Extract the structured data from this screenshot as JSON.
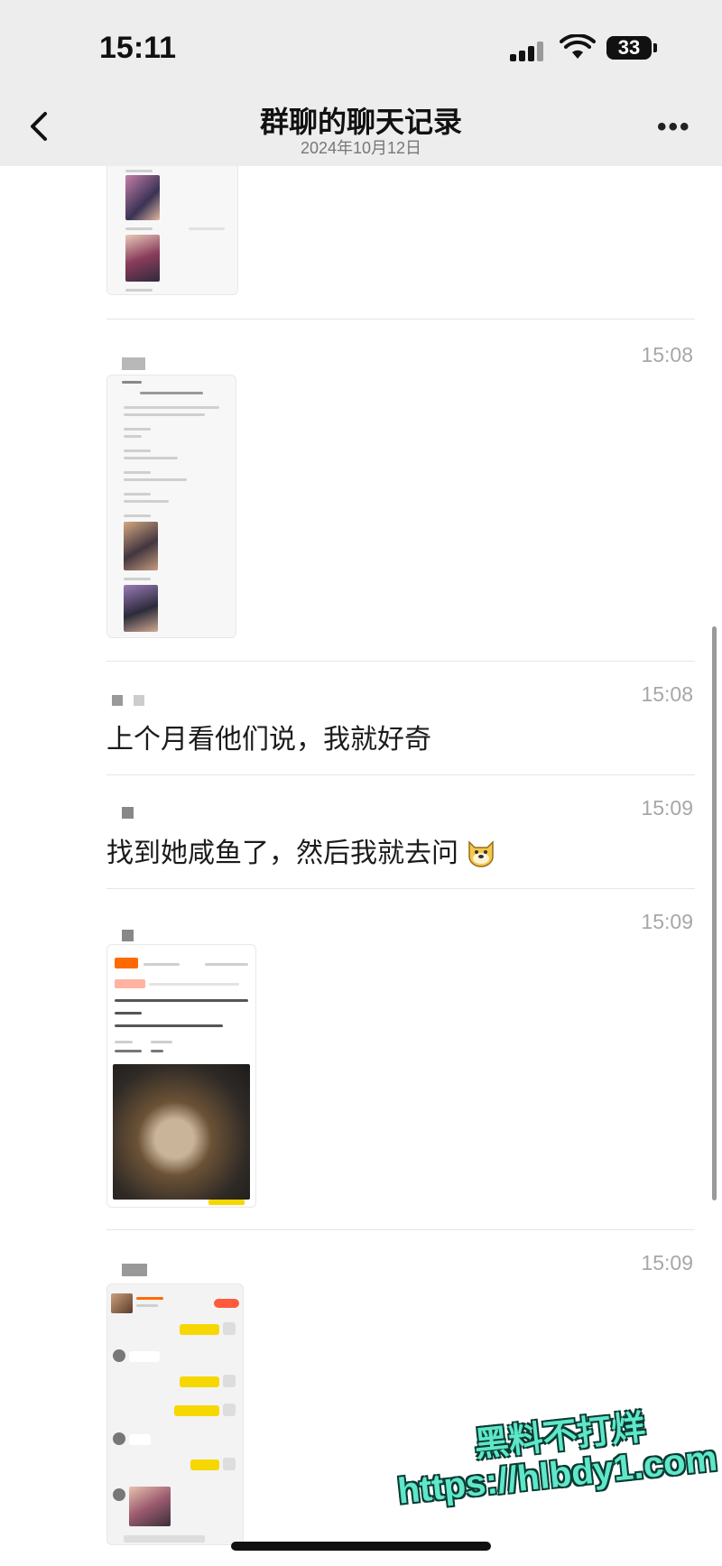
{
  "status_bar": {
    "time": "15:11",
    "battery": "33"
  },
  "nav": {
    "title": "群聊的聊天记录",
    "subtitle": "2024年10月12日"
  },
  "messages": [
    {
      "time": "15:08",
      "type": "image"
    },
    {
      "time": "15:08",
      "type": "text",
      "text": "上个月看他们说，我就好奇"
    },
    {
      "time": "15:09",
      "type": "text",
      "text": "找到她咸鱼了，然后我就去问"
    },
    {
      "time": "15:09",
      "type": "image"
    },
    {
      "time": "15:09",
      "type": "image"
    }
  ],
  "watermark": {
    "line1": "黑料不打烊",
    "line2": "https://hlbdy1.com"
  },
  "colors": {
    "bar_bg": "#ededed",
    "accent_yellow": "#f7d700",
    "watermark": "#5ee7c8"
  }
}
